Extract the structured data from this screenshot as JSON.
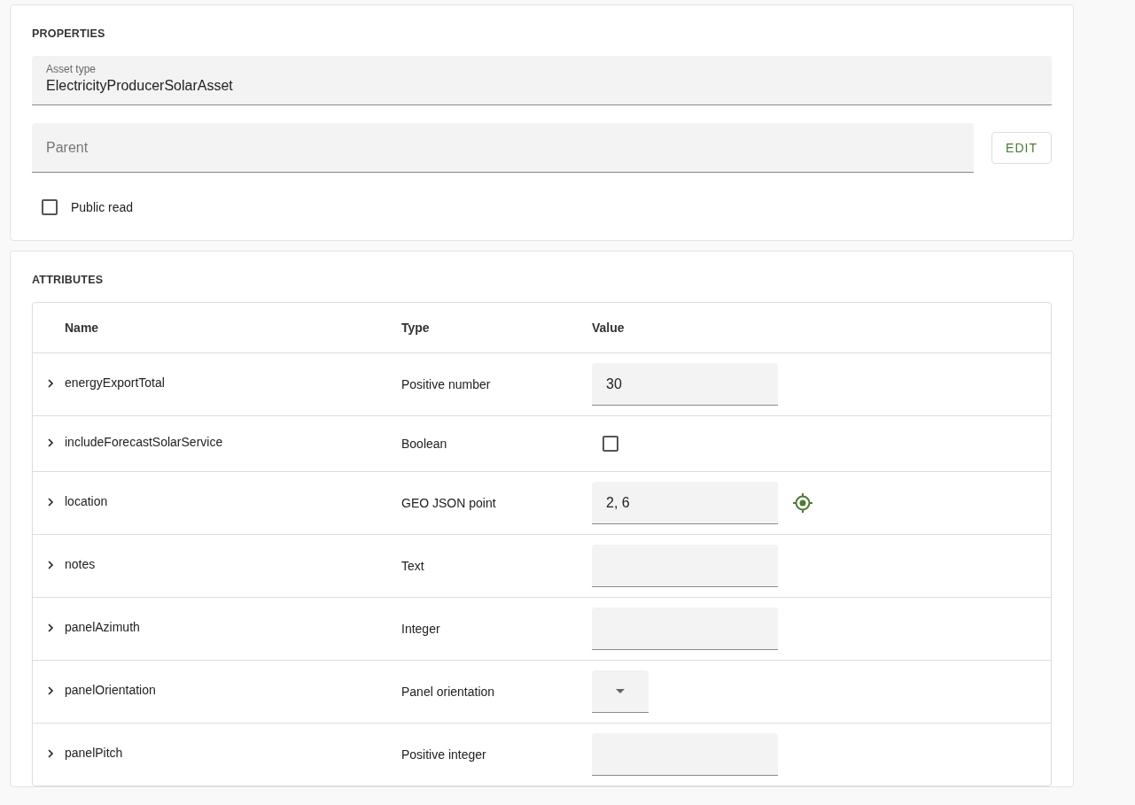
{
  "properties": {
    "title": "PROPERTIES",
    "asset_type": {
      "label": "Asset type",
      "value": "ElectricityProducerSolarAsset"
    },
    "parent": {
      "placeholder": "Parent"
    },
    "edit_button": "EDIT",
    "public_read": {
      "label": "Public read",
      "checked": false
    }
  },
  "attributes": {
    "title": "ATTRIBUTES",
    "columns": [
      "Name",
      "Type",
      "Value"
    ],
    "rows": [
      {
        "name": "energyExportTotal",
        "type": "Positive number",
        "kind": "input",
        "value": "30"
      },
      {
        "name": "includeForecastSolarService",
        "type": "Boolean",
        "kind": "checkbox",
        "checked": false
      },
      {
        "name": "location",
        "type": "GEO JSON point",
        "kind": "location",
        "value": "2, 6"
      },
      {
        "name": "notes",
        "type": "Text",
        "kind": "input"
      },
      {
        "name": "panelAzimuth",
        "type": "Integer",
        "kind": "input"
      },
      {
        "name": "panelOrientation",
        "type": "Panel orientation",
        "kind": "select"
      },
      {
        "name": "panelPitch",
        "type": "Positive integer",
        "kind": "input"
      }
    ]
  }
}
